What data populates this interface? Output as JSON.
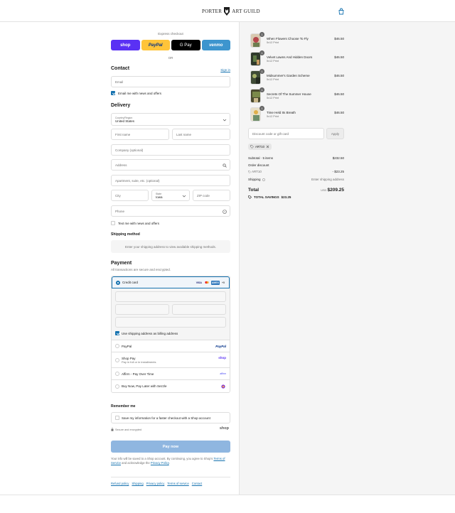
{
  "header": {
    "logo_left": "PORTER",
    "logo_right": "ART GUILD"
  },
  "express": {
    "title": "Express checkout",
    "buttons": [
      {
        "label": "shop"
      },
      {
        "label": "PayPal"
      },
      {
        "label": "G Pay"
      },
      {
        "label": "venmo"
      }
    ],
    "or": "OR"
  },
  "contact": {
    "title": "Contact",
    "sign_in": "Sign in",
    "email_placeholder": "Email",
    "news_label": "Email me with news and offers"
  },
  "delivery": {
    "title": "Delivery",
    "country_label": "Country/Region",
    "country_value": "United States",
    "first_name": "First name",
    "last_name": "Last name",
    "company": "Company (optional)",
    "address": "Address",
    "apartment": "Apartment, suite, etc. (optional)",
    "city": "City",
    "state_label": "State",
    "state_value": "Iowa",
    "zip": "ZIP code",
    "phone": "Phone",
    "text_label": "Text me with news and offers"
  },
  "shipping_method": {
    "title": "Shipping method",
    "notice": "Enter your shipping address to view available shipping methods."
  },
  "payment": {
    "title": "Payment",
    "subtitle": "All transactions are secure and encrypted.",
    "credit_card": "Credit card",
    "card_logos": [
      "VISA",
      "MC",
      "AMEX",
      "+5"
    ],
    "billing_label": "Use shipping address as billing address",
    "options": [
      {
        "label": "PayPal",
        "sub": "",
        "logo": "PayPal"
      },
      {
        "label": "Shop Pay",
        "sub": "Pay in full or in installments",
        "logo": "shop"
      },
      {
        "label": "Affirm - Pay Over Time",
        "sub": "",
        "logo": "affirm"
      },
      {
        "label": "Buy Now, Pay Later with Sezzle",
        "sub": "",
        "logo": "sezzle"
      }
    ]
  },
  "remember": {
    "title": "Remember me",
    "save_label": "Save my information for a faster checkout with a Shop account",
    "secure": "Secure and encrypted",
    "shop_logo": "shop"
  },
  "pay_now": "Pay now",
  "legal": {
    "text1": "Your info will be saved to a Shop account. By continuing, you agree to Shop's",
    "terms": "Terms of Service",
    "and": "and acknowledge the",
    "privacy": "Privacy Policy",
    "dot": "."
  },
  "footer_links": [
    "Refund policy",
    "Shipping",
    "Privacy policy",
    "Terms of service",
    "Contact"
  ],
  "cart": {
    "items": [
      {
        "title": "When Flowers Choose To Fly",
        "variant": "5x12 Print",
        "price": "$46.50",
        "qty": "1"
      },
      {
        "title": "Velvet Lawns And Hidden Doors",
        "variant": "5x12 Print",
        "price": "$46.50",
        "qty": "1"
      },
      {
        "title": "Midsummer's Garden Scheme",
        "variant": "5x12 Print",
        "price": "$46.50",
        "qty": "1"
      },
      {
        "title": "Secrets Of The Summer House",
        "variant": "5x12 Print",
        "price": "$46.50",
        "qty": "1"
      },
      {
        "title": "Time Held Its Breath",
        "variant": "5x12 Print",
        "price": "$46.50",
        "qty": "1"
      }
    ],
    "discount_placeholder": "Discount code or gift card",
    "apply": "Apply",
    "code_chip": "ART10",
    "subtotal_label": "Subtotal · 5 items",
    "subtotal": "$232.50",
    "order_discount": "Order discount",
    "discount_code": "ART10",
    "discount_amount": "- $23.25",
    "shipping_label": "Shipping",
    "shipping_value": "Enter shipping address",
    "total_label": "Total",
    "currency": "USD",
    "total": "$209.25",
    "savings_label": "TOTAL SAVINGS",
    "savings": "$23.25"
  }
}
